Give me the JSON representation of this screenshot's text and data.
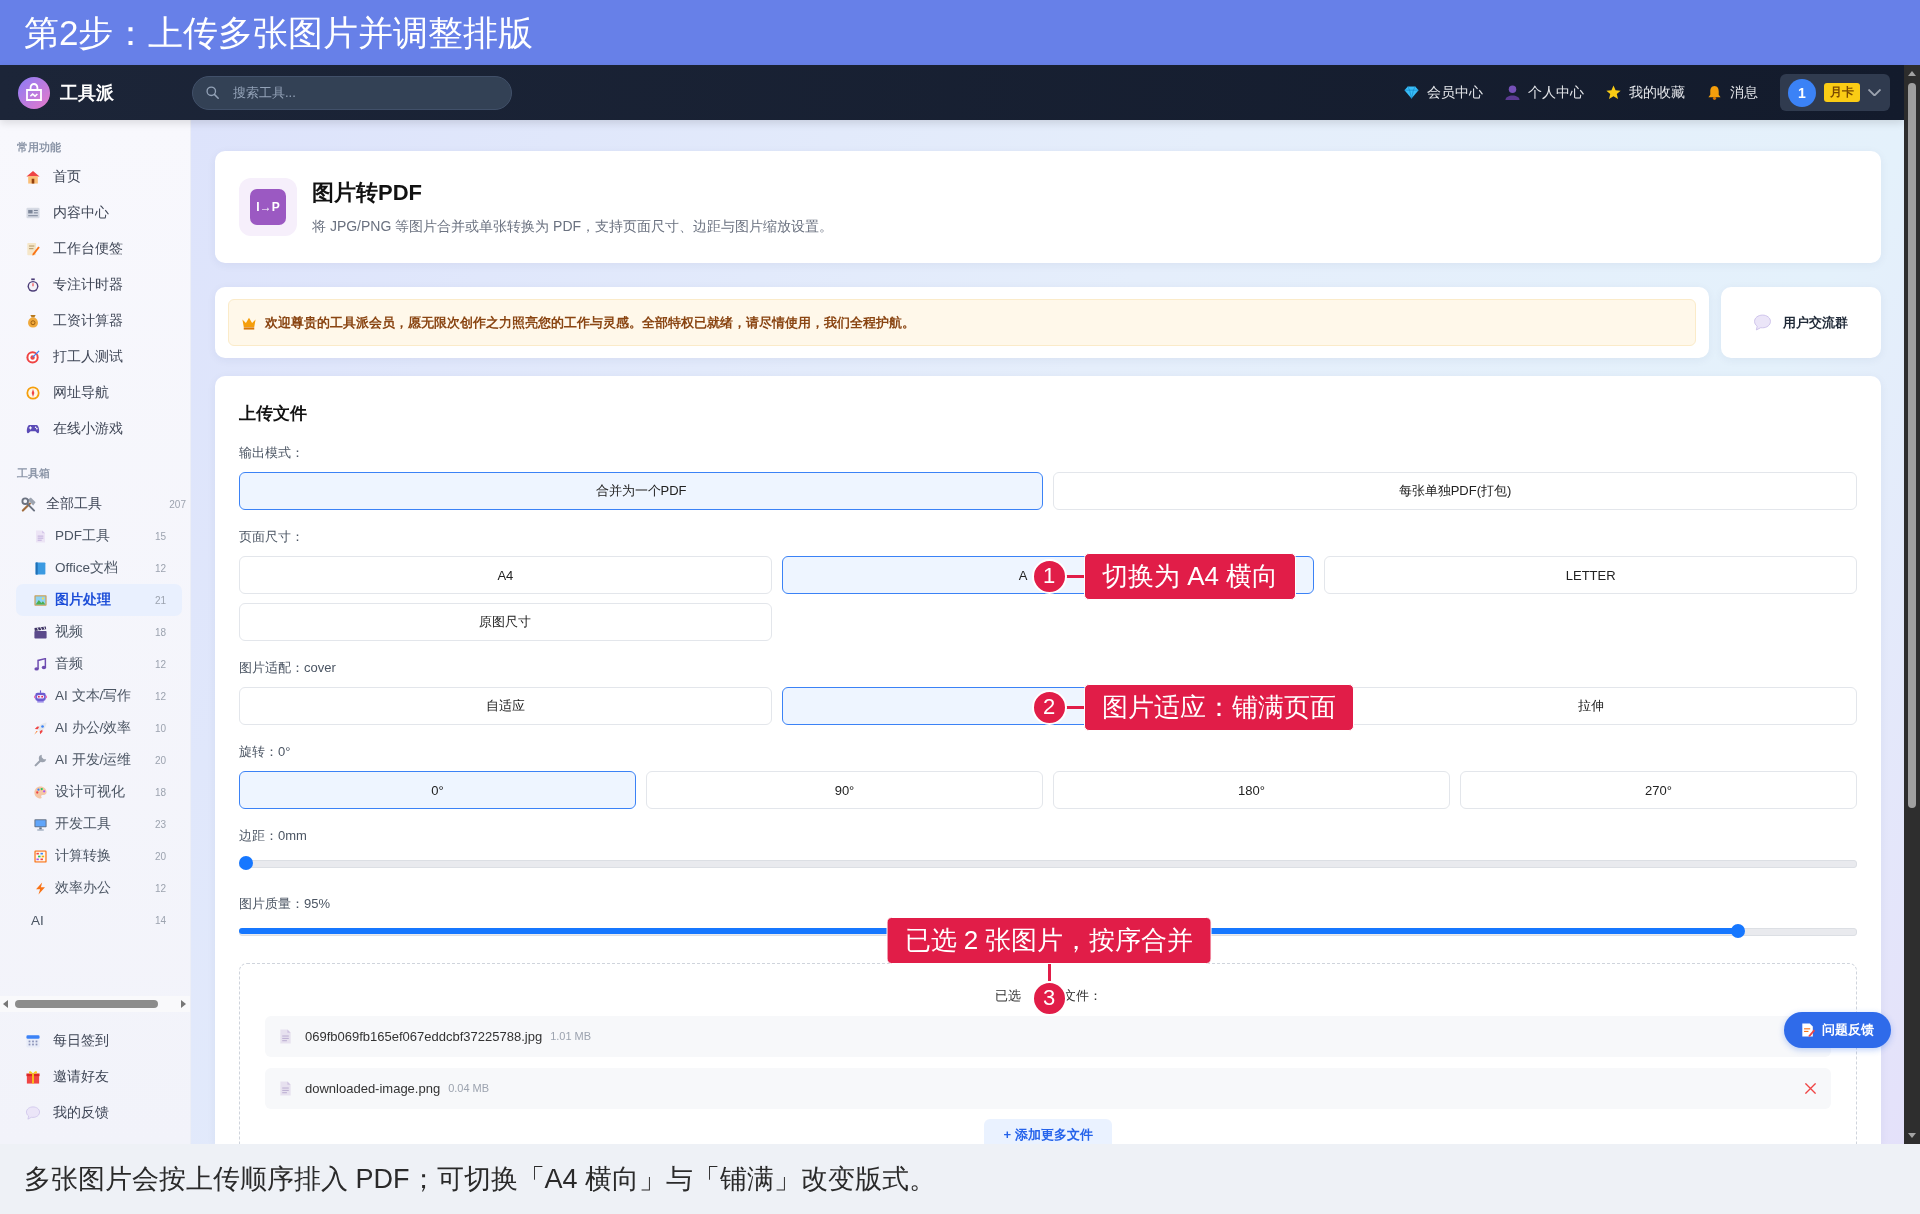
{
  "step_title": "第2步：上传多张图片并调整排版",
  "topbar": {
    "app_name": "工具派",
    "search": {
      "placeholder": "搜索工具..."
    },
    "links": [
      {
        "label": "会员中心"
      },
      {
        "label": "个人中心"
      },
      {
        "label": "我的收藏"
      },
      {
        "label": "消息"
      }
    ],
    "account": {
      "number": "1",
      "plan": "月卡"
    }
  },
  "sidebar": {
    "common": {
      "title": "常用功能",
      "items": [
        {
          "label": "首页",
          "selected": false
        },
        {
          "label": "内容中心",
          "selected": false
        },
        {
          "label": "工作台便签",
          "selected": false
        },
        {
          "label": "专注计时器",
          "selected": false
        },
        {
          "label": "工资计算器",
          "selected": false
        },
        {
          "label": "打工人测试",
          "selected": false
        },
        {
          "label": "网址导航",
          "selected": false
        },
        {
          "label": "在线小游戏",
          "selected": false
        }
      ]
    },
    "toolbox": {
      "title": "工具箱",
      "tree": [
        {
          "label": "全部工具",
          "count": "207",
          "selected": false,
          "children": [
            {
              "label": "PDF工具",
              "count": "15",
              "selected": false
            },
            {
              "label": "Office文档",
              "count": "12",
              "selected": false
            },
            {
              "label": "图片处理",
              "count": "21",
              "selected": true
            },
            {
              "label": "视频",
              "count": "18",
              "selected": false
            },
            {
              "label": "音频",
              "count": "12",
              "selected": false
            },
            {
              "label": "AI 文本/写作",
              "count": "12",
              "selected": false
            },
            {
              "label": "AI 办公/效率",
              "count": "10",
              "selected": false
            },
            {
              "label": "AI 开发/运维",
              "count": "20",
              "selected": false
            },
            {
              "label": "设计可视化",
              "count": "18",
              "selected": false
            },
            {
              "label": "开发工具",
              "count": "23",
              "selected": false
            },
            {
              "label": "计算转换",
              "count": "20",
              "selected": false
            },
            {
              "label": "效率办公",
              "count": "12",
              "selected": false
            },
            {
              "label": "AI",
              "count": "14",
              "selected": false
            }
          ]
        }
      ]
    },
    "footer_items": [
      {
        "label": "每日签到",
        "selected": false
      },
      {
        "label": "邀请好友",
        "selected": false
      },
      {
        "label": "我的反馈",
        "selected": false
      }
    ]
  },
  "header": {
    "logo_text": "I→P",
    "title": "图片转PDF",
    "description": "将 JPG/PNG 等图片合并或单张转换为 PDF，支持页面尺寸、边距与图片缩放设置。"
  },
  "notice": {
    "message": "欢迎尊贵的工具派会员，愿无限次创作之力照亮您的工作与灵感。全部特权已就绪，请尽情使用，我们全程护航。",
    "group_link": "用户交流群"
  },
  "upload": {
    "title": "上传文件",
    "output_mode": {
      "label": "输出模式：",
      "options": [
        {
          "label": "合并为一个PDF",
          "selected": true
        },
        {
          "label": "每张单独PDF(打包)",
          "selected": false
        }
      ]
    },
    "page_size": {
      "label": "页面尺寸：",
      "options": [
        {
          "label": "A4",
          "selected": false,
          "partly_covered": false
        },
        {
          "label": "A",
          "selected": true,
          "partly_covered": true
        },
        {
          "label": "LETTER",
          "selected": false,
          "partly_covered": false
        },
        {
          "label": "原图尺寸",
          "selected": false,
          "partly_covered": false
        }
      ]
    },
    "image_fit": {
      "label": "图片适配：cover",
      "options": [
        {
          "label": "自适应",
          "selected": false
        },
        {
          "selected": true
        },
        {
          "label": "拉伸",
          "selected": false
        }
      ]
    },
    "rotation": {
      "label": "旋转：0°",
      "options": [
        {
          "label": "0°",
          "selected": true
        },
        {
          "label": "90°",
          "selected": false
        },
        {
          "label": "180°",
          "selected": false
        },
        {
          "label": "270°",
          "selected": false
        }
      ]
    },
    "margin": {
      "label": "边距：0mm",
      "level": 0
    },
    "quality": {
      "label": "图片质量：95%",
      "level": 0.93
    },
    "files": {
      "heading_parts": [
        "已选",
        "文件："
      ],
      "items": [
        {
          "name": "069fb069fb165ef067eddcbf37225788.jpg",
          "size": "1.01 MB",
          "remove_icon": false
        },
        {
          "name": "downloaded-image.png",
          "size": "0.04 MB",
          "remove_icon": true
        }
      ],
      "add_more": "+ 添加更多文件"
    }
  },
  "feedback_button": "问题反馈",
  "annotations": [
    {
      "kind": "side",
      "number": "1",
      "text": "切换为 A4 横向"
    },
    {
      "kind": "side",
      "number": "2",
      "text": "图片适应：铺满页面"
    },
    {
      "kind": "above",
      "number": "3",
      "text": "已选 2 张图片，按序合并"
    }
  ],
  "caption": "多张图片会按上传顺序排入 PDF；可切换「A4 横向」与「铺满」改变版式。"
}
